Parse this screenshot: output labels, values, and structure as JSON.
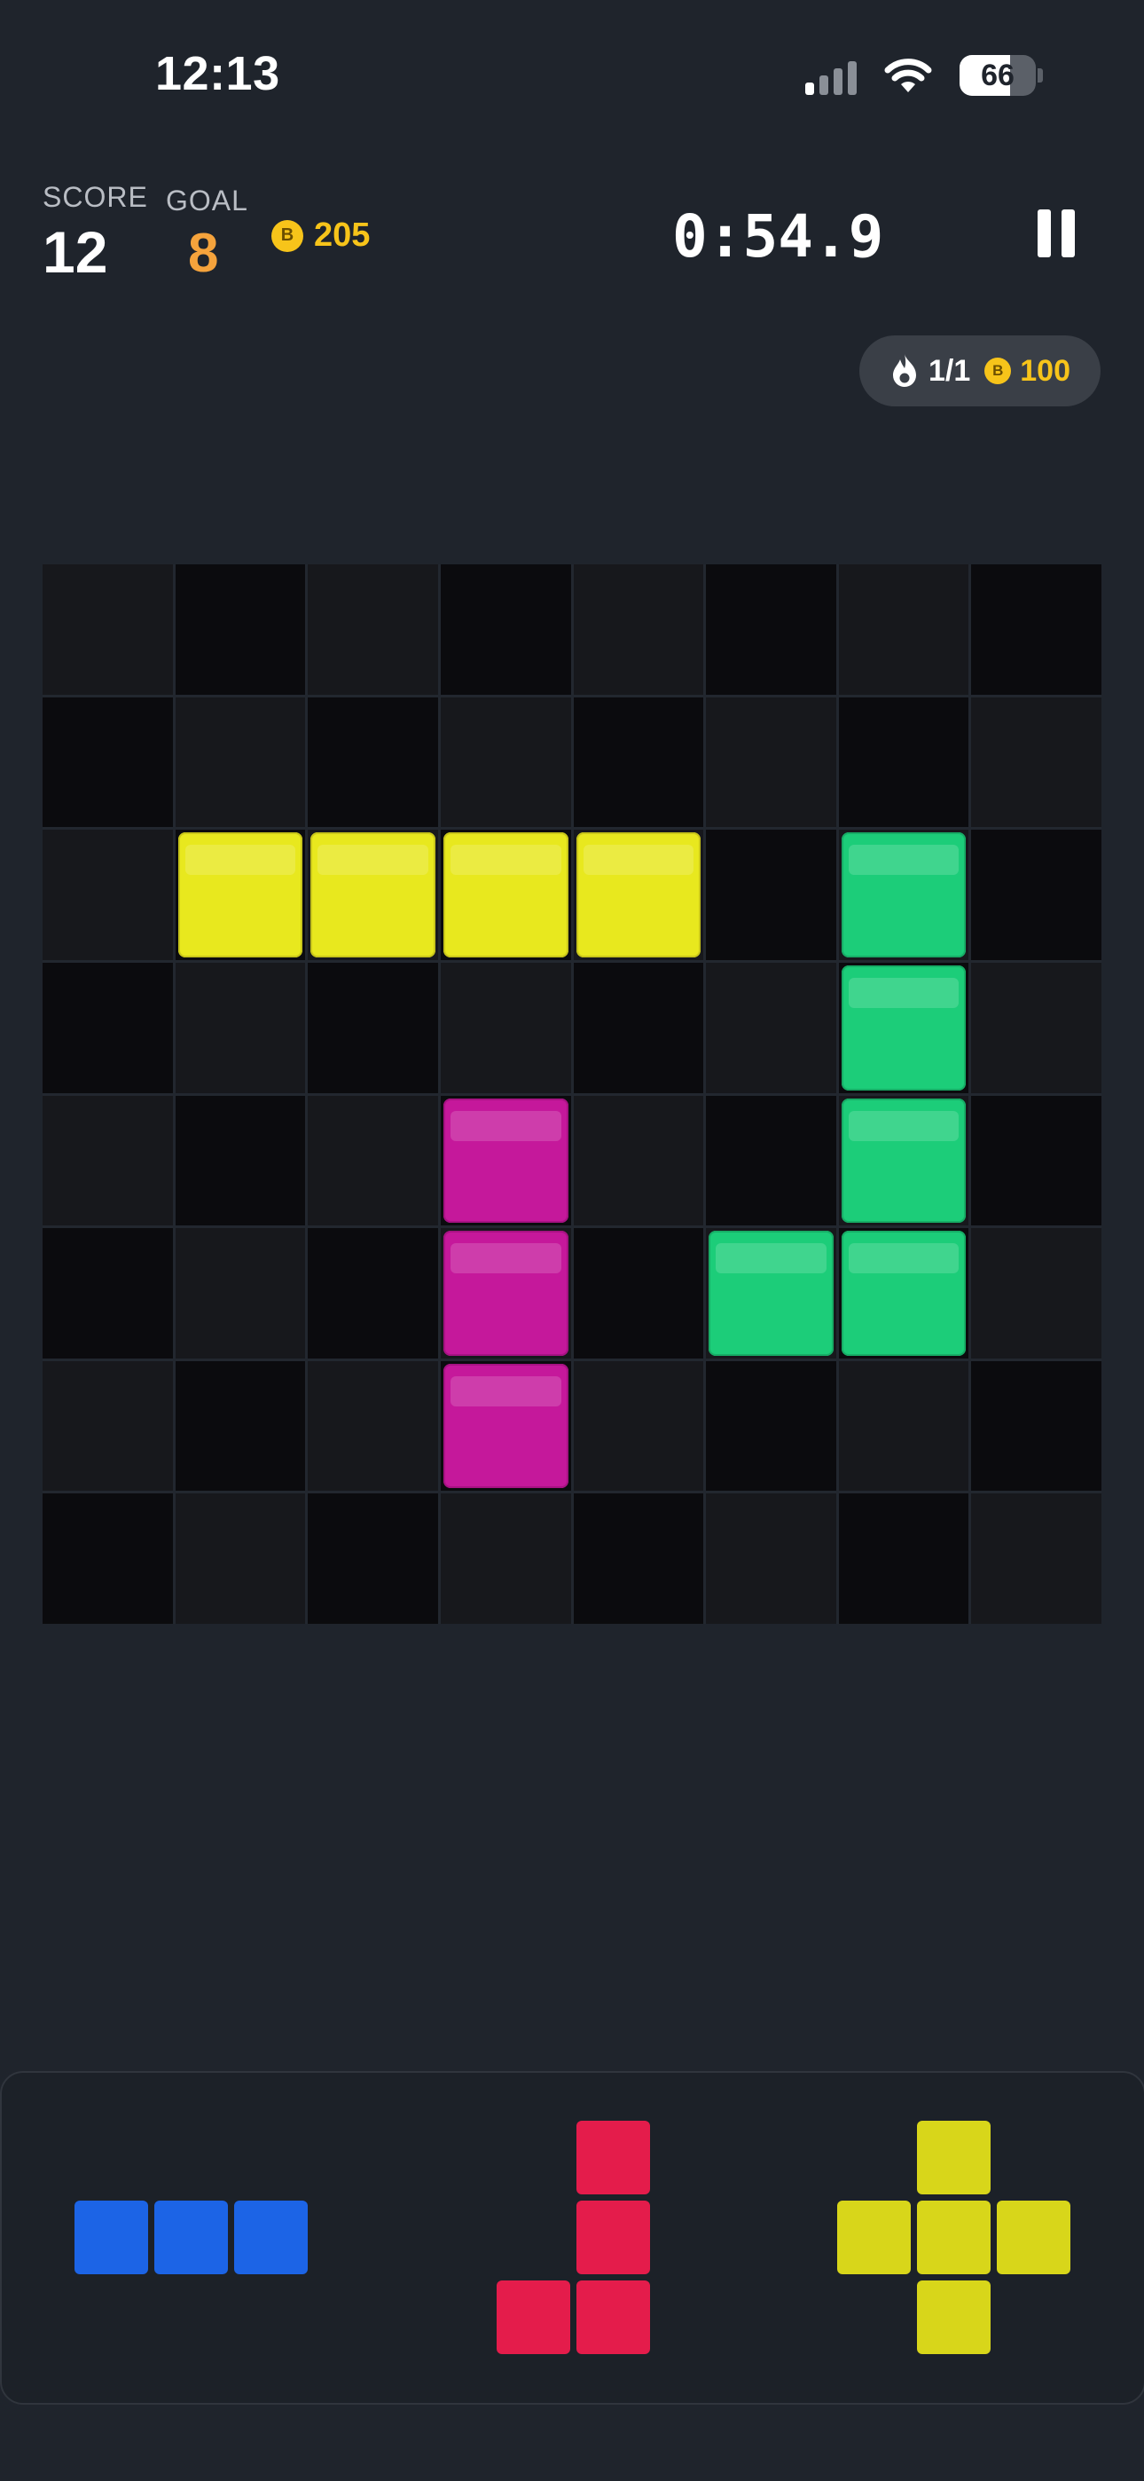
{
  "status_bar": {
    "time": "12:13",
    "battery_text": "66",
    "battery_level": 0.66
  },
  "hud": {
    "score_label": "SCORE",
    "score_value": "12",
    "goal_label": "GOAL",
    "goal_value": "8",
    "coin_symbol": "B",
    "coins_value": "205",
    "timer": "0:54.9"
  },
  "streak": {
    "text": "1/1",
    "reward": "100"
  },
  "board": {
    "rows": 8,
    "cols": 8,
    "blocks": [
      {
        "r": 2,
        "c": 1,
        "color": "yellow"
      },
      {
        "r": 2,
        "c": 2,
        "color": "yellow"
      },
      {
        "r": 2,
        "c": 3,
        "color": "yellow"
      },
      {
        "r": 2,
        "c": 4,
        "color": "yellow"
      },
      {
        "r": 2,
        "c": 6,
        "color": "green"
      },
      {
        "r": 3,
        "c": 6,
        "color": "green"
      },
      {
        "r": 4,
        "c": 6,
        "color": "green"
      },
      {
        "r": 5,
        "c": 5,
        "color": "green"
      },
      {
        "r": 5,
        "c": 6,
        "color": "green"
      },
      {
        "r": 4,
        "c": 3,
        "color": "magenta"
      },
      {
        "r": 5,
        "c": 3,
        "color": "magenta"
      },
      {
        "r": 6,
        "c": 3,
        "color": "magenta"
      }
    ]
  },
  "tray": {
    "pieces": [
      {
        "name": "piece-blue-line",
        "color": "blue",
        "cells": [
          [
            0,
            0
          ],
          [
            0,
            1
          ],
          [
            0,
            2
          ]
        ]
      },
      {
        "name": "piece-red-j",
        "color": "red",
        "cells": [
          [
            0,
            1
          ],
          [
            1,
            1
          ],
          [
            2,
            0
          ],
          [
            2,
            1
          ]
        ]
      },
      {
        "name": "piece-lime-plus",
        "color": "lime",
        "cells": [
          [
            0,
            1
          ],
          [
            1,
            0
          ],
          [
            1,
            1
          ],
          [
            1,
            2
          ],
          [
            2,
            1
          ]
        ]
      }
    ]
  },
  "colors": {
    "yellow": "#e8e81e",
    "green": "#1ccd79",
    "magenta": "#c5189b",
    "blue": "#1c64e6",
    "red": "#e41c4b",
    "lime": "#d8d61a",
    "goal": "#f5a33c",
    "coin": "#f7c41a"
  }
}
